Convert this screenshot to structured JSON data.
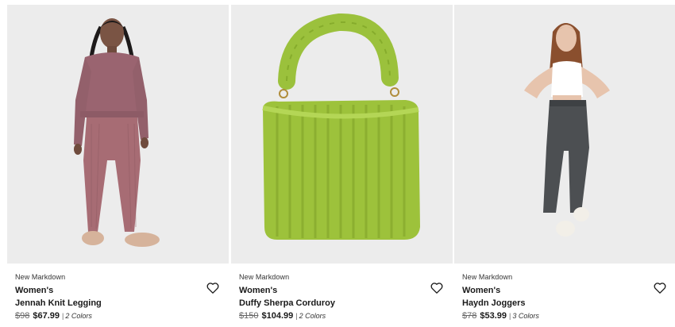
{
  "products": [
    {
      "badge": "New Markdown",
      "gender": "Women's",
      "name": "Jennah Knit Legging",
      "old_price": "$98",
      "new_price": "$67.99",
      "separator": "|",
      "colors": "2 Colors",
      "image_alt": "woman wearing mauve knit sweater and leggings with fuzzy slippers",
      "wishlist_icon": "heart-icon"
    },
    {
      "badge": "New Markdown",
      "gender": "Women's",
      "name": "Duffy Sherpa Corduroy",
      "old_price": "$150",
      "new_price": "$104.99",
      "separator": "|",
      "colors": "2 Colors",
      "image_alt": "lime green fuzzy shoulder bag",
      "wishlist_icon": "heart-icon"
    },
    {
      "badge": "New Markdown",
      "gender": "Women's",
      "name": "Haydn Joggers",
      "old_price": "$78",
      "new_price": "$53.99",
      "separator": "|",
      "colors": "3 Colors",
      "image_alt": "woman wearing white tank top and grey joggers",
      "wishlist_icon": "heart-icon"
    }
  ],
  "colors": {
    "image_bg": "#ececec",
    "text": "#1a1a1a",
    "muted": "#666666"
  }
}
